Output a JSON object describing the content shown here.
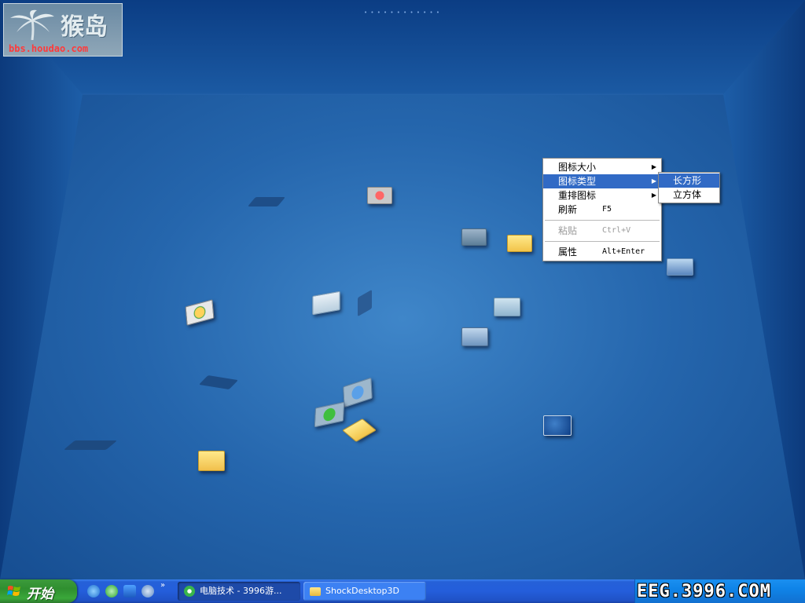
{
  "watermark": {
    "site_name": "猴岛",
    "site_url": "bbs.houdao.com",
    "ticker": "• • • • • • • • • • • •"
  },
  "desktop": {
    "icons": [
      "folder-icon",
      "folder-icon",
      "open-folder-icon",
      "network-icon",
      "computer-icon",
      "cd-icon",
      "ie-icon",
      "ie-icon",
      "msn-icon",
      "document-icon",
      "picture-icon",
      "recycle-icon"
    ]
  },
  "context_menu": {
    "items": [
      {
        "label": "图标大小",
        "shortcut": "",
        "submenu": true
      },
      {
        "label": "图标类型",
        "shortcut": "",
        "submenu": true,
        "selected": true
      },
      {
        "label": "重排图标",
        "shortcut": "",
        "submenu": true
      },
      {
        "label": "刷新",
        "shortcut": "F5",
        "submenu": false
      },
      {
        "label": "粘贴",
        "shortcut": "Ctrl+V",
        "submenu": false,
        "disabled": true
      },
      {
        "label": "属性",
        "shortcut": "Alt+Enter",
        "submenu": false
      }
    ],
    "submenu_items": [
      {
        "label": "长方形",
        "selected": true
      },
      {
        "label": "立方体",
        "selected": false
      }
    ]
  },
  "taskbar": {
    "start_label": "开始",
    "quick_launch": [
      "ie-icon",
      "msn-icon",
      "back-icon",
      "media-icon"
    ],
    "more": "»",
    "tasks": [
      {
        "label": "电脑技术 - 3996游...",
        "icon": "ie-icon",
        "active": true
      },
      {
        "label": "ShockDesktop3D",
        "icon": "folder-icon",
        "active": false
      }
    ],
    "tray_watermark": "EEG.3996.COM"
  },
  "colors": {
    "desktop_blue": "#0b3f86",
    "menu_highlight": "#316ac5",
    "start_green": "#3a9a3a",
    "taskbar_blue": "#245edb"
  }
}
